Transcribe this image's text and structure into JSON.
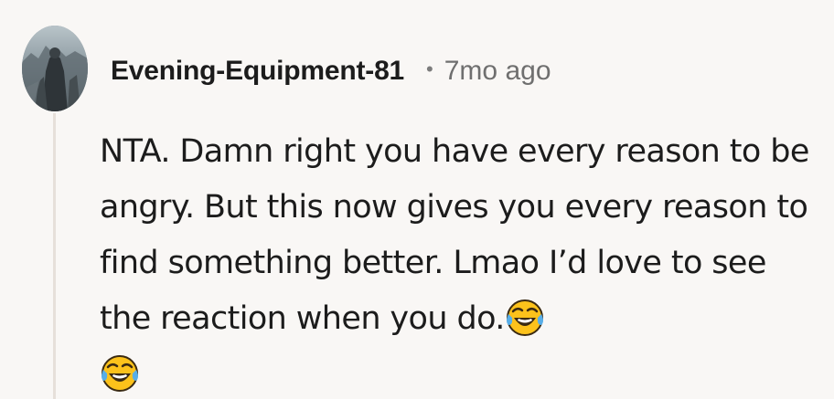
{
  "comment": {
    "author": "Evening-Equipment-81",
    "separator": "•",
    "timestamp": "7mo ago",
    "body": "NTA. Damn right you have every reason to be angry. But this now gives you every reason to find something better. Lmao I’d love to see the reaction when you do.",
    "emojis": [
      "face-with-tears-of-joy-icon",
      "face-with-tears-of-joy-icon"
    ]
  },
  "colors": {
    "background": "#f9f7f5",
    "thread_line": "#e6e0da",
    "text": "#1c1c1c",
    "meta_text": "#6f6f6f"
  }
}
